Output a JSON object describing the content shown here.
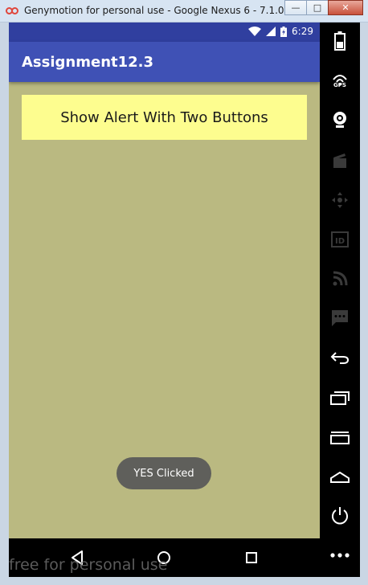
{
  "window": {
    "title": "Genymotion for personal use - Google Nexus 6 - 7.1.0 - ...",
    "minimize_label": "—",
    "maximize_label": "□",
    "close_label": "✕"
  },
  "status_bar": {
    "time": "6:29"
  },
  "app_bar": {
    "title": "Assignment12.3"
  },
  "main": {
    "alert_button_label": "Show Alert With Two Buttons"
  },
  "toast": {
    "text": "YES Clicked"
  },
  "toolbar": {
    "gps_label": "GPS",
    "id_label": "ID",
    "items": [
      "battery-icon",
      "gps-icon",
      "webcam-icon",
      "media-icon",
      "dpad-icon",
      "identifiers-icon",
      "network-icon",
      "sms-icon",
      "back-icon",
      "recent-apps-icon",
      "menu-icon",
      "home-icon",
      "power-icon",
      "more-icon"
    ]
  },
  "watermark": {
    "text": "free for personal use"
  },
  "colors": {
    "status_bar": "#303f9f",
    "app_bar": "#3f51b5",
    "background": "#bab981",
    "button": "#fdfd8f",
    "toast": "#5f5f5b"
  }
}
